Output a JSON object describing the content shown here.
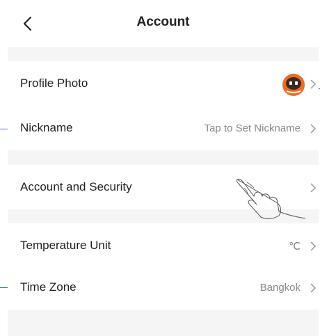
{
  "header": {
    "title": "Account"
  },
  "rows": [
    {
      "label": "Profile Photo",
      "value": ""
    },
    {
      "label": "Nickname",
      "value": "Tap to Set Nickname"
    },
    {
      "label": "Account and Security",
      "value": ""
    },
    {
      "label": "Temperature Unit",
      "value": "℃"
    },
    {
      "label": "Time Zone",
      "value": "Bangkok"
    }
  ],
  "icons": {
    "back": "chevron-left-icon",
    "chevron": "chevron-right-icon",
    "avatar": "robot-avatar-icon",
    "gesture": "tap-hand-icon"
  },
  "colors": {
    "background": "#f5f5f5",
    "card": "#ffffff",
    "text": "#222222",
    "secondary_text": "#888888",
    "avatar_orange": "#f26a21",
    "callout_line": "#3a6fc0"
  }
}
